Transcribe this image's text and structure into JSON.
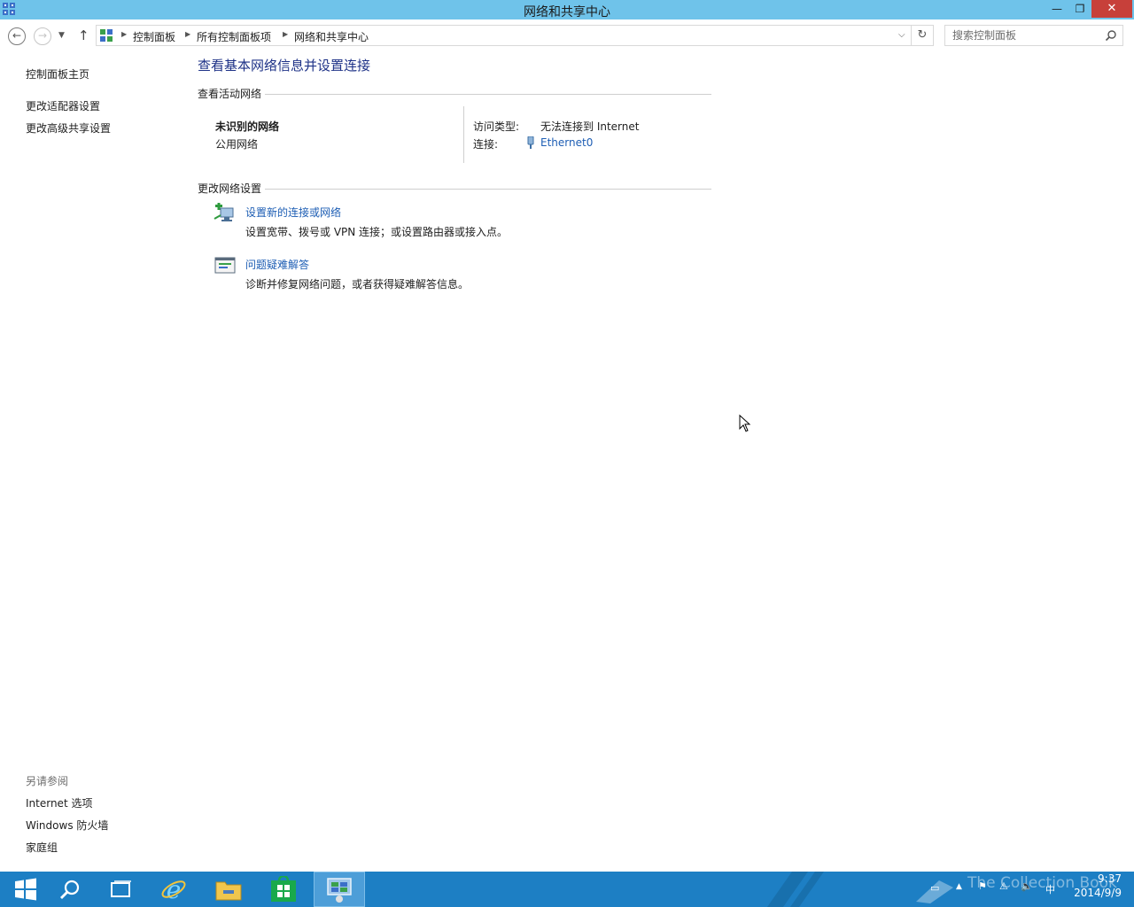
{
  "window": {
    "title": "网络和共享中心",
    "minimize_glyph": "—",
    "restore_glyph": "❐",
    "close_glyph": "✕"
  },
  "nav": {
    "breadcrumbs": [
      "控制面板",
      "所有控制面板项",
      "网络和共享中心"
    ],
    "search_placeholder": "搜索控制面板"
  },
  "sidebar": {
    "home": "控制面板主页",
    "links": [
      "更改适配器设置",
      "更改高级共享设置"
    ],
    "see_also_title": "另请参阅",
    "see_also": [
      "Internet 选项",
      "Windows 防火墙",
      "家庭组"
    ]
  },
  "main": {
    "title": "查看基本网络信息并设置连接",
    "active_networks_header": "查看活动网络",
    "network_name": "未识别的网络",
    "network_type": "公用网络",
    "access_type_label": "访问类型:",
    "access_type_value": "无法连接到 Internet",
    "connection_label": "连接:",
    "connection_value": "Ethernet0",
    "change_settings_header": "更改网络设置",
    "tasks": [
      {
        "title": "设置新的连接或网络",
        "description": "设置宽带、拨号或 VPN 连接；或设置路由器或接入点。",
        "icon": "new-connection-icon"
      },
      {
        "title": "问题疑难解答",
        "description": "诊断并修复网络问题，或者获得疑难解答信息。",
        "icon": "troubleshoot-icon"
      }
    ]
  },
  "taskbar": {
    "apps": [
      "start-icon",
      "search-icon",
      "task-view-icon",
      "internet-explorer-icon",
      "file-explorer-icon",
      "store-icon",
      "control-panel-icon"
    ],
    "tray_ime": "中",
    "watermark": "The Collection Book",
    "clock_time": "9:37",
    "clock_date": "2014/9/9"
  },
  "colors": {
    "titlebar": "#6fc3ea",
    "taskbar": "#1d7fc4",
    "link": "#1e5eb4",
    "heading": "#1e3287"
  }
}
